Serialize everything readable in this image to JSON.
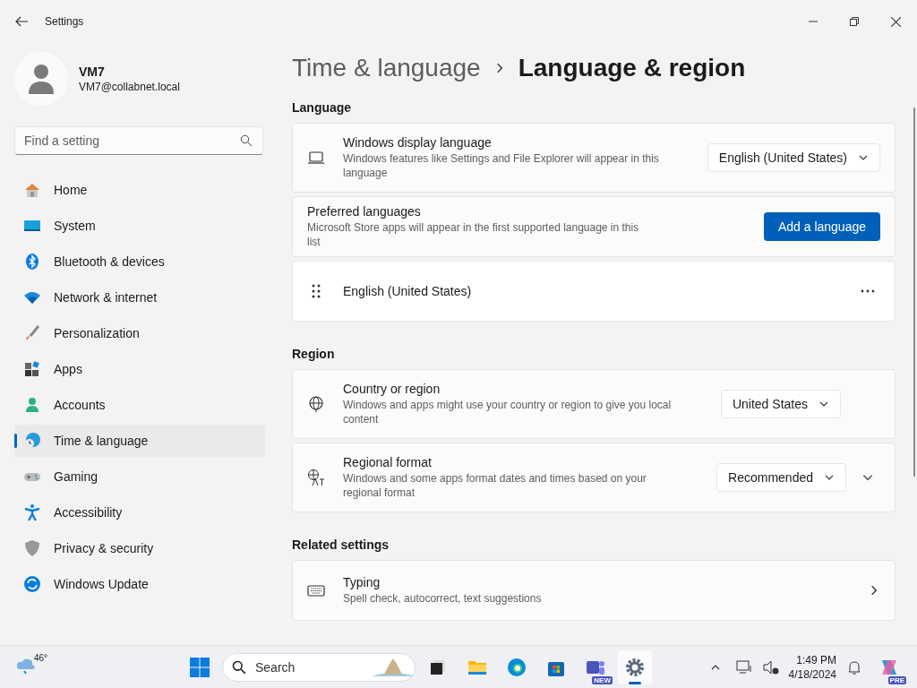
{
  "window": {
    "title": "Settings"
  },
  "user": {
    "name": "VM7",
    "email": "VM7@collabnet.local"
  },
  "search": {
    "placeholder": "Find a setting"
  },
  "sidebar": {
    "items": [
      {
        "label": "Home",
        "selected": false
      },
      {
        "label": "System",
        "selected": false
      },
      {
        "label": "Bluetooth & devices",
        "selected": false
      },
      {
        "label": "Network & internet",
        "selected": false
      },
      {
        "label": "Personalization",
        "selected": false
      },
      {
        "label": "Apps",
        "selected": false
      },
      {
        "label": "Accounts",
        "selected": false
      },
      {
        "label": "Time & language",
        "selected": true
      },
      {
        "label": "Gaming",
        "selected": false
      },
      {
        "label": "Accessibility",
        "selected": false
      },
      {
        "label": "Privacy & security",
        "selected": false
      },
      {
        "label": "Windows Update",
        "selected": false
      }
    ]
  },
  "breadcrumb": {
    "parent": "Time & language",
    "current": "Language & region"
  },
  "sections": [
    {
      "heading": "Language",
      "rows": [
        {
          "kind": "dropdown",
          "title": "Windows display language",
          "description": "Windows features like Settings and File Explorer will appear in this language",
          "value": "English (United States)"
        },
        {
          "kind": "button",
          "title": "Preferred languages",
          "description": "Microsoft Store apps will appear in the first supported language in this list",
          "button": "Add a language"
        },
        {
          "kind": "language",
          "title": "English (United States)"
        }
      ]
    },
    {
      "heading": "Region",
      "rows": [
        {
          "kind": "dropdown",
          "title": "Country or region",
          "description": "Windows and apps might use your country or region to give you local content",
          "value": "United States"
        },
        {
          "kind": "expander",
          "title": "Regional format",
          "description": "Windows and some apps format dates and times based on your regional format",
          "value": "Recommended"
        }
      ]
    },
    {
      "heading": "Related settings",
      "rows": [
        {
          "kind": "link",
          "title": "Typing",
          "description": "Spell check, autocorrect, text suggestions"
        }
      ]
    }
  ],
  "taskbar": {
    "temperature": "46°",
    "search_placeholder": "Search",
    "apps": [
      {
        "selected": false
      },
      {
        "selected": false
      },
      {
        "selected": false
      },
      {
        "selected": false
      },
      {
        "selected": false,
        "badge": "NEW"
      },
      {
        "selected": true
      }
    ],
    "time": "1:49 PM",
    "date": "4/18/2024",
    "copilot_badge": "PRE"
  }
}
